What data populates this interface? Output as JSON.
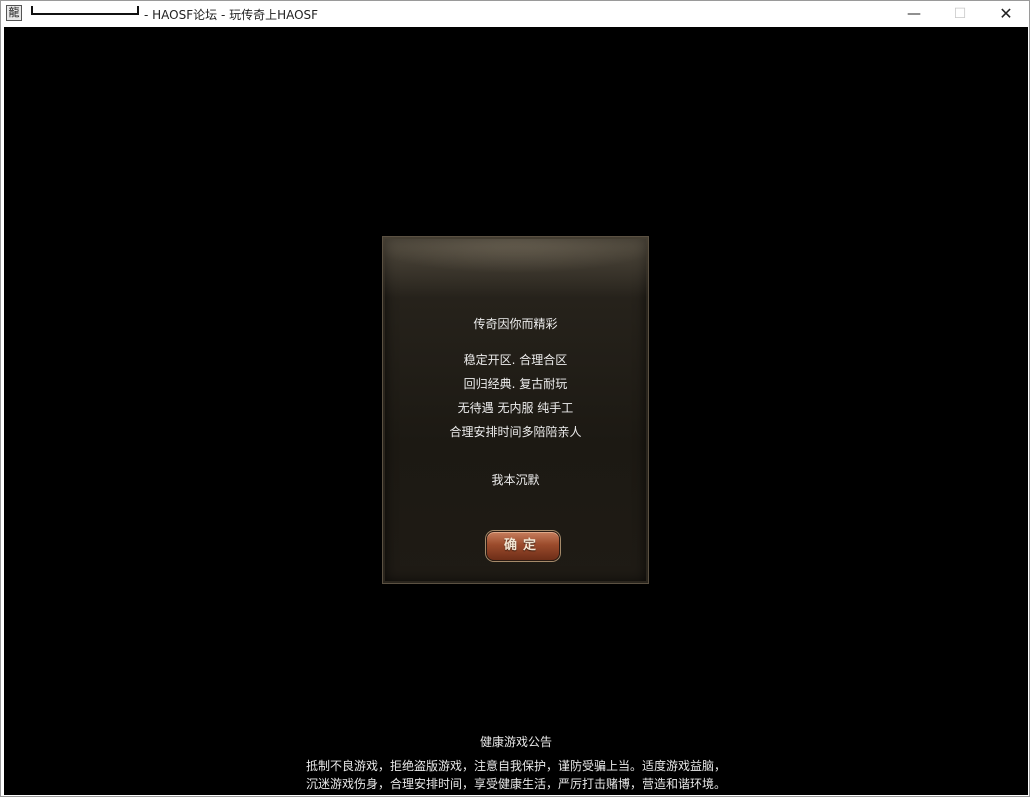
{
  "window": {
    "app_icon": "app-icon",
    "title": "- HAOSF论坛 - 玩传奇上HAOSF",
    "minimize_glyph": "—",
    "maximize_glyph": "☐",
    "close_glyph": "✕"
  },
  "dialog": {
    "heading": "传奇因你而精彩",
    "lines": [
      "稳定开区. 合理合区",
      "回归经典. 复古耐玩",
      "无待遇  无内服  纯手工",
      "合理安排时间多陪陪亲人"
    ],
    "signature": "我本沉默",
    "confirm_label": "确定"
  },
  "notice": {
    "title": "健康游戏公告",
    "line1": "抵制不良游戏，拒绝盗版游戏，注意自我保护，谨防受骗上当。适度游戏益脑，",
    "line2": "沉迷游戏伤身，合理安排时间，享受健康生活，严厉打击赌博，营造和谐环境。"
  },
  "colors": {
    "game_background": "#000000",
    "dialog_text": "#ededed",
    "button_brown": "#9b4b2c"
  }
}
